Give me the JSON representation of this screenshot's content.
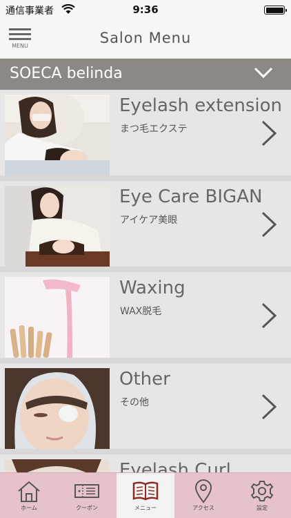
{
  "status_bar": {
    "carrier": "通信事業者",
    "time": "9:36"
  },
  "header": {
    "menu_label": "MENU",
    "title": "Salon Menu"
  },
  "salon_selector": {
    "name": "SOECA belinda"
  },
  "menu_items": [
    {
      "title": "Eyelash extension",
      "subtitle": "まつ毛エクステ"
    },
    {
      "title": "Eye Care BIGAN",
      "subtitle": "アイケア美眼"
    },
    {
      "title": "Waxing",
      "subtitle": "WAX脱毛"
    },
    {
      "title": "Other",
      "subtitle": "その他"
    },
    {
      "title": "Eyelash Curl",
      "subtitle": ""
    }
  ],
  "tab_bar": {
    "tabs": [
      {
        "label": "ホーム",
        "icon": "home-icon"
      },
      {
        "label": "クーポン",
        "icon": "coupon-icon"
      },
      {
        "label": "メニュー",
        "icon": "menu-book-icon",
        "active": true
      },
      {
        "label": "アクセス",
        "icon": "map-pin-icon"
      },
      {
        "label": "設定",
        "icon": "gear-icon"
      }
    ]
  },
  "colors": {
    "salon_bar": "#8c8883",
    "tab_bar": "#e6c3cb",
    "list_bg": "#e6e6e6"
  }
}
